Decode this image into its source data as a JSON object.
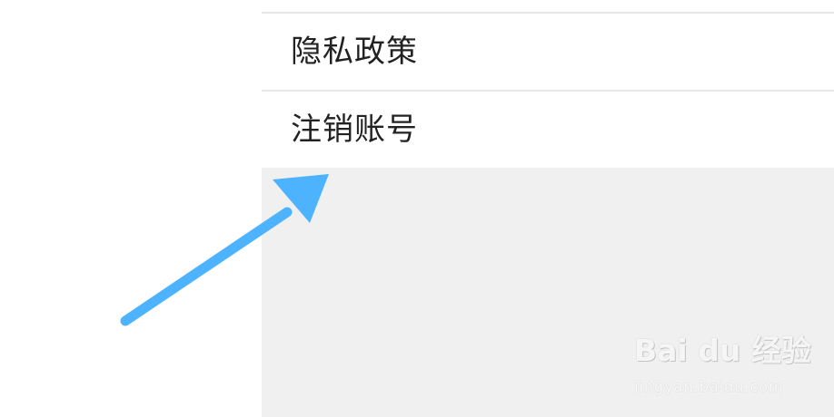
{
  "settings": {
    "items": [
      {
        "label": "隐私政策"
      },
      {
        "label": "注销账号"
      }
    ]
  },
  "annotation": {
    "arrow_color": "#4db3ff",
    "target": "注销账号"
  },
  "watermark": {
    "brand": "Bai du 经验",
    "url": "jingyan.baidu.com"
  },
  "colors": {
    "page_bg": "#ffffff",
    "screen_bg": "#f0f0f0",
    "divider": "#e7e7e7",
    "text": "#222222"
  }
}
